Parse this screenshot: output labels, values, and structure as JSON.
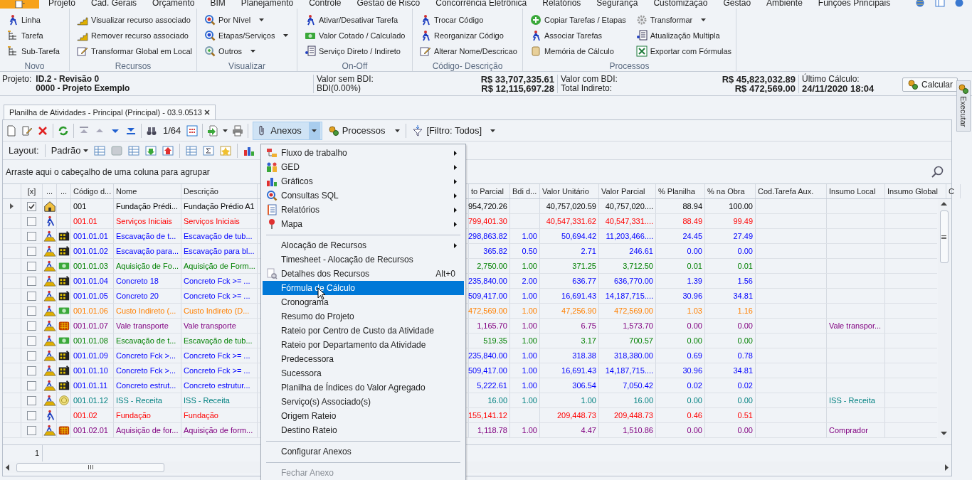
{
  "ribbon_tabs": [
    "Projeto",
    "Cad. Gerais",
    "Orçamento",
    "BIM",
    "Planejamento",
    "Controle",
    "Gestão de Risco",
    "Concorrência Eletrônica",
    "Relatórios",
    "Segurança",
    "Customização",
    "Gestão",
    "Ambiente",
    "Funções Principais"
  ],
  "ribbon_groups": [
    {
      "label": "Novo",
      "columns": [
        [
          {
            "label": "Linha",
            "dropdown": false
          },
          {
            "label": "Tarefa",
            "dropdown": false
          },
          {
            "label": "Sub-Tarefa",
            "dropdown": false
          }
        ]
      ]
    },
    {
      "label": "Recursos",
      "columns": [
        [
          {
            "label": "Visualizar recurso associado",
            "dropdown": false
          },
          {
            "label": "Remover recurso associado",
            "dropdown": false
          },
          {
            "label": "Transformar Global em Local",
            "dropdown": false
          }
        ]
      ]
    },
    {
      "label": "Visualizar",
      "columns": [
        [
          {
            "label": "Por Nível",
            "dropdown": true
          },
          {
            "label": "Etapas/Serviços",
            "dropdown": true
          },
          {
            "label": "Outros",
            "dropdown": true
          }
        ]
      ]
    },
    {
      "label": "On-Off",
      "columns": [
        [
          {
            "label": "Ativar/Desativar Tarefa",
            "dropdown": false
          },
          {
            "label": "Valor Cotado / Calculado",
            "dropdown": false
          },
          {
            "label": "Serviço Direto / Indireto",
            "dropdown": false
          }
        ]
      ]
    },
    {
      "label": "Código- Descrição",
      "columns": [
        [
          {
            "label": "Trocar Código",
            "dropdown": false
          },
          {
            "label": "Reorganizar Código",
            "dropdown": false
          },
          {
            "label": "Alterar Nome/Descricao",
            "dropdown": false
          }
        ]
      ]
    },
    {
      "label": "Processos",
      "columns": [
        [
          {
            "label": "Copiar Tarefas / Etapas",
            "dropdown": false
          },
          {
            "label": "Associar Tarefas",
            "dropdown": false
          },
          {
            "label": "Memória de Cálculo",
            "dropdown": false
          }
        ],
        [
          {
            "label": "Transformar",
            "dropdown": true
          },
          {
            "label": "Atualização Multipla",
            "dropdown": false
          },
          {
            "label": "Exportar com Fórmulas",
            "dropdown": false
          }
        ]
      ]
    }
  ],
  "project_bar": {
    "project_label": "Projeto:",
    "project_id": "ID.2 - Revisão 0",
    "project_name": "0000 - Projeto Exemplo",
    "summary": [
      [
        {
          "label": "Valor sem BDI:",
          "value": "R$ 33,707,335.61"
        },
        {
          "label": "BDI(0.00%)",
          "value": "R$ 12,115,697.28"
        }
      ],
      [
        {
          "label": "Valor com BDI:",
          "value": "R$ 45,823,032.89"
        },
        {
          "label": "Total Indireto:",
          "value": "R$ 472,569.00"
        }
      ]
    ],
    "last_calc_label": "Último Cálculo:",
    "last_calc_value": "24/11/2020 18:04",
    "calculate_button": "Calcular"
  },
  "document_tab": "Planilha de Atividades - Principal (Principal) - 03.9.0513",
  "side_tab": "Executar",
  "toolbar": {
    "record_position": "1/64",
    "attachments_button": {
      "label": "Anexos",
      "open": true
    },
    "processes_button": "Processos",
    "filter_button": "[Filtro: Todos]"
  },
  "layout_bar": {
    "label": "Layout:",
    "layout_dropdown": "Padrão"
  },
  "group_panel_hint": "Arraste aqui o cabeçalho de uma coluna para agrupar",
  "grid": {
    "columns": [
      "[x]",
      "...",
      "...",
      "Código d...",
      "Nome",
      "Descrição",
      "to Parcial",
      "Bdi d...",
      "Valor Unitário",
      "Valor Parcial",
      "% Planilha",
      "% na Obra",
      "Cod.Tarefa Aux.",
      "Insumo Local",
      "Insumo Global",
      "C"
    ],
    "rows": [
      {
        "kind": "project",
        "selected": true,
        "checked": true,
        "color": "#000000",
        "code": "001",
        "name": "Fundação Prédi...",
        "description": "Fundação Prédio A1",
        "partial_cost": "954,720.26",
        "unit_value": "40,757,020.59",
        "partial_value": "40,757,020....",
        "pct_sheet": "88.94",
        "pct_work": "100.00"
      },
      {
        "kind": "stage",
        "selected": false,
        "checked": false,
        "color": "#ff0000",
        "code": "001.01",
        "name": "Serviços Iniciais",
        "description": "Serviços Iniciais",
        "partial_cost": "799,401.30",
        "unit_value": "40,547,331.62",
        "partial_value": "40,547,331....",
        "pct_sheet": "88.49",
        "pct_work": "99.49"
      },
      {
        "kind": "equipment",
        "selected": false,
        "checked": false,
        "color": "#0000ff",
        "code": "001.01.01",
        "name": "Escavação de t...",
        "description": "Escavação de tub...",
        "partial_cost": "298,863.82",
        "bdi": "1.00",
        "unit_value": "50,694.42",
        "partial_value": "11,203,466....",
        "pct_sheet": "24.45",
        "pct_work": "27.49"
      },
      {
        "kind": "equipment",
        "selected": false,
        "checked": false,
        "color": "#0000ff",
        "code": "001.01.02",
        "name": "Escavação para...",
        "description": "Escavação para bl...",
        "partial_cost": "365.82",
        "bdi": "0.50",
        "unit_value": "2.71",
        "partial_value": "246.61",
        "pct_sheet": "0.00",
        "pct_work": "0.00"
      },
      {
        "kind": "cost",
        "selected": false,
        "checked": false,
        "color": "#008000",
        "code": "001.01.03",
        "name": "Aquisição de Fo...",
        "description": "Aquisição de Form...",
        "partial_cost": "2,750.00",
        "bdi": "1.00",
        "unit_value": "371.25",
        "partial_value": "3,712.50",
        "pct_sheet": "0.01",
        "pct_work": "0.01"
      },
      {
        "kind": "equipment",
        "selected": false,
        "checked": false,
        "color": "#0000ff",
        "code": "001.01.04",
        "name": "Concreto 18",
        "description": "Concreto Fck >= ...",
        "partial_cost": "235,840.00",
        "bdi": "2.00",
        "unit_value": "636.77",
        "partial_value": "636,770.00",
        "pct_sheet": "1.39",
        "pct_work": "1.56"
      },
      {
        "kind": "equipment",
        "selected": false,
        "checked": false,
        "color": "#0000ff",
        "code": "001.01.05",
        "name": "Concreto 20",
        "description": "Concreto Fck >= ...",
        "partial_cost": "509,417.00",
        "bdi": "1.00",
        "unit_value": "16,691.43",
        "partial_value": "14,187,715....",
        "pct_sheet": "30.96",
        "pct_work": "34.81"
      },
      {
        "kind": "cost",
        "selected": false,
        "checked": false,
        "color": "#ff8000",
        "code": "001.01.06",
        "name": "Custo Indireto (...",
        "description": "Custo Indireto (D...",
        "partial_cost": "472,569.00",
        "bdi": "1.00",
        "unit_value": "47,256.90",
        "partial_value": "472,569.00",
        "pct_sheet": "1.03",
        "pct_work": "1.16"
      },
      {
        "kind": "material",
        "selected": false,
        "checked": false,
        "color": "#800080",
        "code": "001.01.07",
        "name": "Vale transporte",
        "description": "Vale transporte",
        "partial_cost": "1,165.70",
        "bdi": "1.00",
        "unit_value": "6.75",
        "partial_value": "1,573.70",
        "pct_sheet": "0.00",
        "pct_work": "0.00",
        "local_input": "Vale transpor..."
      },
      {
        "kind": "cost",
        "selected": false,
        "checked": false,
        "color": "#008000",
        "code": "001.01.08",
        "name": "Escavação de t...",
        "description": "Escavação de tub...",
        "partial_cost": "519.35",
        "bdi": "1.00",
        "unit_value": "3.17",
        "partial_value": "700.57",
        "pct_sheet": "0.00",
        "pct_work": "0.00"
      },
      {
        "kind": "equipment",
        "selected": false,
        "checked": false,
        "color": "#0000ff",
        "code": "001.01.09",
        "name": "Concreto Fck >...",
        "description": "Concreto Fck >= ...",
        "partial_cost": "235,840.00",
        "bdi": "1.00",
        "unit_value": "318.38",
        "partial_value": "318,380.00",
        "pct_sheet": "0.69",
        "pct_work": "0.78"
      },
      {
        "kind": "equipment",
        "selected": false,
        "checked": false,
        "color": "#0000ff",
        "code": "001.01.10",
        "name": "Concreto Fck >...",
        "description": "Concreto Fck >= ...",
        "partial_cost": "509,417.00",
        "bdi": "1.00",
        "unit_value": "16,691.43",
        "partial_value": "14,187,715....",
        "pct_sheet": "30.96",
        "pct_work": "34.81"
      },
      {
        "kind": "equipment",
        "selected": false,
        "checked": false,
        "color": "#0000ff",
        "code": "001.01.11",
        "name": "Concreto estrut...",
        "description": "Concreto estrutur...",
        "partial_cost": "5,222.61",
        "bdi": "1.00",
        "unit_value": "306.54",
        "partial_value": "7,050.42",
        "pct_sheet": "0.02",
        "pct_work": "0.02"
      },
      {
        "kind": "tax",
        "selected": false,
        "checked": false,
        "color": "#008080",
        "code": "001.01.12",
        "name": "ISS - Receita",
        "description": "ISS - Receita",
        "partial_cost": "16.00",
        "bdi": "1.00",
        "unit_value": "1.00",
        "partial_value": "16.00",
        "pct_sheet": "0.00",
        "pct_work": "0.00",
        "local_input": "ISS - Receita"
      },
      {
        "kind": "stage",
        "selected": false,
        "checked": false,
        "color": "#ff0000",
        "code": "001.02",
        "name": "Fundação",
        "description": "Fundação",
        "partial_cost": "155,141.12",
        "unit_value": "209,448.73",
        "partial_value": "209,448.73",
        "pct_sheet": "0.46",
        "pct_work": "0.51"
      },
      {
        "kind": "material",
        "selected": false,
        "checked": false,
        "color": "#800080",
        "code": "001.02.01",
        "name": "Aquisição de for...",
        "description": "Aquisição de form...",
        "partial_cost": "1,118.78",
        "bdi": "1.00",
        "unit_value": "4.47",
        "partial_value": "1,510.86",
        "pct_sheet": "0.00",
        "pct_work": "0.00",
        "local_input": "Comprador"
      }
    ]
  },
  "footer_cell": "1",
  "attachments_menu": {
    "sections": [
      [
        {
          "label": "Fluxo de trabalho",
          "submenu": true,
          "selected": false,
          "disabled": false
        },
        {
          "label": "GED",
          "submenu": true,
          "selected": false,
          "disabled": false
        },
        {
          "label": "Gráficos",
          "submenu": true,
          "selected": false,
          "disabled": false
        },
        {
          "label": "Consultas SQL",
          "submenu": true,
          "selected": false,
          "disabled": false
        },
        {
          "label": "Relatórios",
          "submenu": true,
          "selected": false,
          "disabled": false
        },
        {
          "label": "Mapa",
          "submenu": true,
          "selected": false,
          "disabled": false
        }
      ],
      [
        {
          "label": "Alocação de Recursos",
          "submenu": true,
          "selected": false,
          "disabled": false
        },
        {
          "label": "Timesheet - Alocação de Recursos",
          "submenu": false,
          "selected": false,
          "disabled": false
        },
        {
          "label": "Detalhes dos Recursos",
          "shortcut": "Alt+0",
          "submenu": false,
          "selected": false,
          "disabled": false
        },
        {
          "label": "Fórmula de Cálculo",
          "submenu": false,
          "selected": true,
          "disabled": false
        },
        {
          "label": "Cronograma",
          "submenu": false,
          "selected": false,
          "disabled": false
        },
        {
          "label": "Resumo do Projeto",
          "submenu": false,
          "selected": false,
          "disabled": false
        },
        {
          "label": "Rateio por Centro de Custo da Atividade",
          "submenu": false,
          "selected": false,
          "disabled": false
        },
        {
          "label": "Rateio por Departamento da Atividade",
          "submenu": false,
          "selected": false,
          "disabled": false
        },
        {
          "label": "Predecessora",
          "submenu": false,
          "selected": false,
          "disabled": false
        },
        {
          "label": "Sucessora",
          "submenu": false,
          "selected": false,
          "disabled": false
        },
        {
          "label": "Planilha de Índices do Valor Agregado",
          "submenu": false,
          "selected": false,
          "disabled": false
        },
        {
          "label": "Serviço(s) Associado(s)",
          "submenu": false,
          "selected": false,
          "disabled": false
        },
        {
          "label": "Origem Rateio",
          "submenu": false,
          "selected": false,
          "disabled": false
        },
        {
          "label": "Destino Rateio",
          "submenu": false,
          "selected": false,
          "disabled": false
        }
      ],
      [
        {
          "label": "Configurar Anexos",
          "submenu": false,
          "selected": false,
          "disabled": false
        }
      ],
      [
        {
          "label": "Fechar Anexo",
          "submenu": false,
          "selected": false,
          "disabled": true
        }
      ]
    ]
  }
}
